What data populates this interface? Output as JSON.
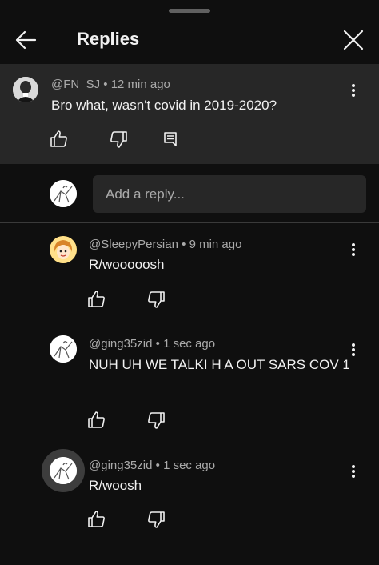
{
  "header": {
    "title": "Replies"
  },
  "parent_comment": {
    "author": "@FN_SJ",
    "separator": "•",
    "time": "12 min ago",
    "text": "Bro what, wasn't covid in 2019-2020?"
  },
  "compose": {
    "placeholder": "Add a reply..."
  },
  "replies": [
    {
      "author": "@SleepyPersian",
      "separator": "•",
      "time": "9 min ago",
      "text": "R/wooooosh"
    },
    {
      "author": "@ging35zid",
      "separator": "•",
      "time": "1 sec ago",
      "text": "NUH UH WE TALKI H A OUT SARS COV 1"
    },
    {
      "author": "@ging35zid",
      "separator": "•",
      "time": "1 sec ago",
      "text": "R/woosh"
    }
  ],
  "icons": {
    "back": "arrow-left-icon",
    "close": "close-icon",
    "like": "thumbs-up-icon",
    "dislike": "thumbs-down-icon",
    "reply": "comment-icon",
    "more": "more-vertical-icon"
  },
  "colors": {
    "background": "#0f0f0f",
    "highlight": "#272727",
    "text": "#f1f1f1",
    "secondary_text": "#aaaaaa"
  }
}
